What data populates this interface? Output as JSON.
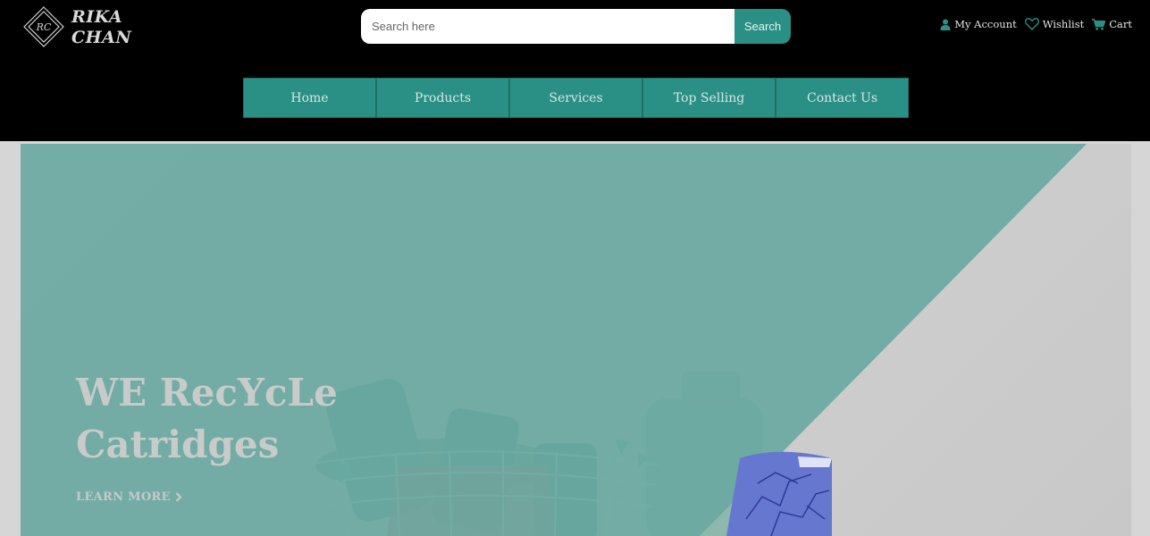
{
  "brand": {
    "monogram": "RC",
    "line1": "RIKA",
    "line2": "CHAN"
  },
  "search": {
    "placeholder": "Search here",
    "button_label": "Search"
  },
  "account": {
    "my_account": "My Account",
    "wishlist": "Wishlist",
    "cart": "Cart"
  },
  "nav": {
    "items": [
      "Home",
      "Products",
      "Services",
      "Top Selling",
      "Contact Us"
    ]
  },
  "hero": {
    "title_line1": "WE RecYcLe",
    "title_line2": "Catridges",
    "cta_label": "LEARN MORE"
  },
  "colors": {
    "accent": "#2a9085",
    "header_bg": "#000000",
    "hero_overlay": "#6ba9a0"
  },
  "icons": {
    "account": "user-icon",
    "wishlist": "heart-icon",
    "cart": "cart-icon",
    "cta": "chevron-right-icon"
  }
}
